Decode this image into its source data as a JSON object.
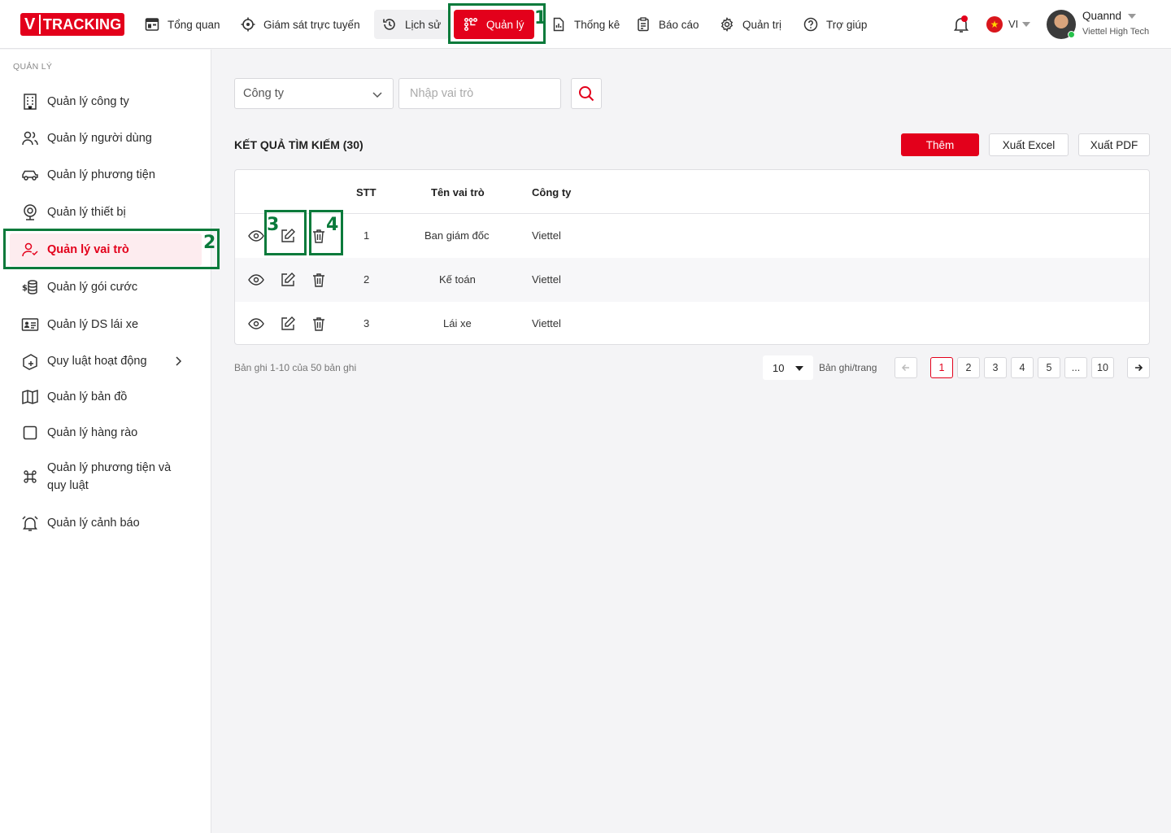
{
  "logo": {
    "v": "V",
    "name": "TRACKING"
  },
  "nav": [
    {
      "label": "Tổng quan",
      "icon": "dashboard-icon"
    },
    {
      "label": "Giám sát trực tuyến",
      "icon": "crosshair-icon"
    },
    {
      "label": "Lịch sử",
      "icon": "history-icon"
    },
    {
      "label": "Quản lý",
      "icon": "nodes-icon"
    },
    {
      "label": "Thống kê",
      "icon": "report-chart-icon"
    },
    {
      "label": "Báo cáo",
      "icon": "clipboard-icon"
    },
    {
      "label": "Quản trị",
      "icon": "gear-icon"
    },
    {
      "label": "Trợ giúp",
      "icon": "help-icon"
    }
  ],
  "lang": "VI",
  "user": {
    "name": "Quannd",
    "org": "Viettel High Tech"
  },
  "annotations": [
    "1",
    "2",
    "3",
    "4"
  ],
  "sidebar": {
    "title": "QUẢN LÝ",
    "items": [
      {
        "label": "Quản lý công ty",
        "icon": "building-icon"
      },
      {
        "label": "Quản lý người dùng",
        "icon": "users-icon"
      },
      {
        "label": "Quản lý phương tiện",
        "icon": "car-icon"
      },
      {
        "label": "Quản lý thiết bị",
        "icon": "webcam-icon"
      },
      {
        "label": "Quản lý vai trò",
        "icon": "user-check-icon"
      },
      {
        "label": "Quản lý gói cước",
        "icon": "coins-icon"
      },
      {
        "label": "Quản lý DS lái xe",
        "icon": "id-card-icon"
      },
      {
        "label": "Quy luật hoạt động",
        "icon": "rules-icon"
      },
      {
        "label": "Quản lý bản đồ",
        "icon": "map-icon"
      },
      {
        "label": "Quản lý hàng rào",
        "icon": "square-icon"
      },
      {
        "label": "Quản lý phương tiện và",
        "label2": "quy luật",
        "icon": "command-icon"
      },
      {
        "label": "Quản lý cảnh báo",
        "icon": "alarm-icon"
      }
    ]
  },
  "filters": {
    "company_select": "Công ty",
    "role_placeholder": "Nhập vai trò"
  },
  "results": {
    "title": "KẾT QUẢ TÌM KIẾM (30)"
  },
  "buttons": {
    "add": "Thêm",
    "excel": "Xuất Excel",
    "pdf": "Xuất PDF"
  },
  "table": {
    "headers": {
      "stt": "STT",
      "role": "Tên vai trò",
      "company": "Công ty"
    },
    "rows": [
      {
        "stt": "1",
        "role": "Ban giám đốc",
        "company": "Viettel"
      },
      {
        "stt": "2",
        "role": "Kế toán",
        "company": "Viettel"
      },
      {
        "stt": "3",
        "role": "Lái xe",
        "company": "Viettel"
      }
    ]
  },
  "pagination": {
    "summary": "Bản ghi 1-10 của 50 bản ghi",
    "page_size": "10",
    "per_page_label": "Bản ghi/trang",
    "pages": [
      "1",
      "2",
      "3",
      "4",
      "5",
      "...",
      "10"
    ],
    "current": "1"
  },
  "colors": {
    "brand": "#e3001b",
    "annotation": "#0a7a3b",
    "active_bg": "#fdecef"
  }
}
